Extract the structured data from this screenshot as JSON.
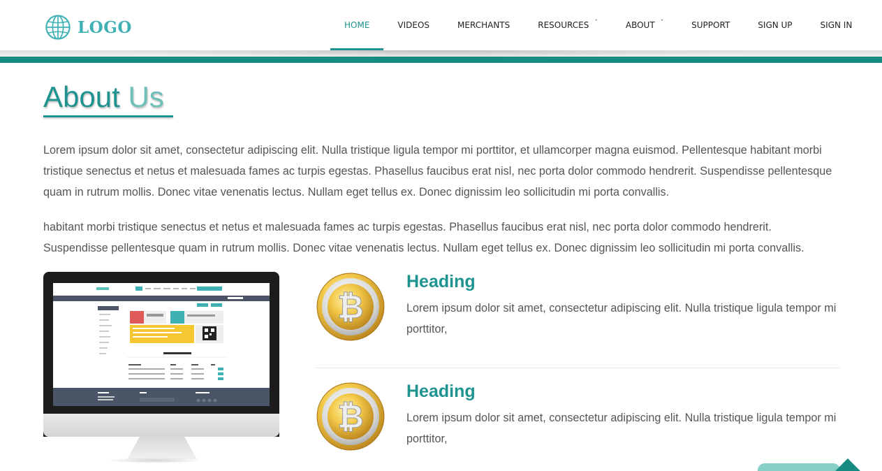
{
  "header": {
    "logo_text": "LOGO",
    "logo_icon": "globe-icon",
    "nav": [
      {
        "label": "HOME",
        "active": true
      },
      {
        "label": "VIDEOS"
      },
      {
        "label": "MERCHANTS"
      },
      {
        "label": "RESOURCES",
        "dropdown": true
      },
      {
        "label": "ABOUT",
        "dropdown": true
      },
      {
        "label": "SUPPORT"
      },
      {
        "label": "SIGN UP"
      },
      {
        "label": "SIGN IN"
      }
    ],
    "caret_glyph": "ˇ"
  },
  "main": {
    "title_word1": "About",
    "title_word2": "Us",
    "paragraphs": [
      "Lorem ipsum dolor sit amet, consectetur adipiscing elit. Nulla tristique ligula tempor mi porttitor, et ullamcorper magna euismod. Pellentesque habitant morbi tristique senectus et netus et malesuada fames ac turpis egestas. Phasellus faucibus erat nisl, nec porta dolor commodo hendrerit. Suspendisse pellentesque quam in rutrum mollis. Donec vitae venenatis lectus. Nullam eget tellus ex. Donec dignissim leo sollicitudin mi porta convallis.",
      "habitant morbi tristique senectus et netus et malesuada fames ac turpis egestas. Phasellus faucibus erat nisl, nec porta dolor commodo hendrerit. Suspendisse pellentesque quam in rutrum mollis. Donec vitae venenatis lectus. Nullam eget tellus ex. Donec dignissim leo sollicitudin mi porta convallis."
    ],
    "features": [
      {
        "heading": "Heading",
        "text": "Lorem ipsum dolor sit amet, consectetur adipiscing elit. Nulla tristique ligula tempor mi porttitor,",
        "icon": "bitcoin-coin-icon"
      },
      {
        "heading": "Heading",
        "text": "Lorem ipsum dolor sit amet, consectetur adipiscing elit. Nulla tristique ligula tempor mi porttitor,",
        "icon": "bitcoin-coin-icon"
      }
    ]
  },
  "colors": {
    "accent": "#1e9390",
    "accent_light": "#6fc0b9",
    "header_bar": "#178a82",
    "text": "#555555"
  },
  "back_to_top_icon": "arrow-up-icon"
}
